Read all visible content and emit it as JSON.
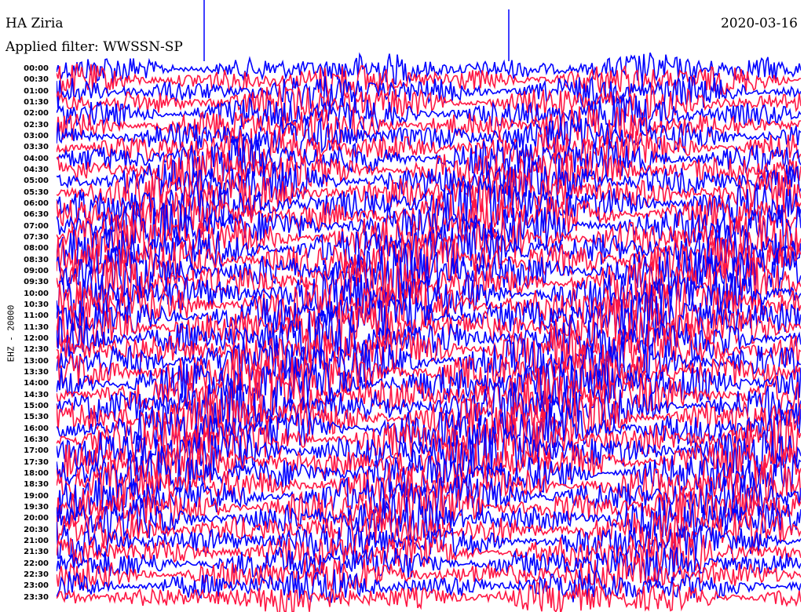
{
  "header": {
    "station": "HA Ziria",
    "date": "2020-03-16",
    "filter": "Applied filter: WWSSN-SP"
  },
  "chart_data": {
    "type": "line",
    "title": "HA Ziria",
    "ylabel": "EHZ - 20000",
    "row_labels": [
      "00:00",
      "00:30",
      "01:00",
      "01:30",
      "02:00",
      "02:30",
      "03:00",
      "03:30",
      "04:00",
      "04:30",
      "05:00",
      "05:30",
      "06:00",
      "06:30",
      "07:00",
      "07:30",
      "08:00",
      "08:30",
      "09:00",
      "09:30",
      "10:00",
      "10:30",
      "11:00",
      "11:30",
      "12:00",
      "12:30",
      "13:00",
      "13:30",
      "14:00",
      "14:30",
      "15:00",
      "15:30",
      "16:00",
      "16:30",
      "17:00",
      "17:30",
      "18:00",
      "18:30",
      "19:00",
      "19:30",
      "20:00",
      "20:30",
      "21:00",
      "21:30",
      "22:00",
      "22:30",
      "23:00",
      "23:30"
    ],
    "colors": [
      "#0000ff",
      "#ff1744"
    ]
  }
}
